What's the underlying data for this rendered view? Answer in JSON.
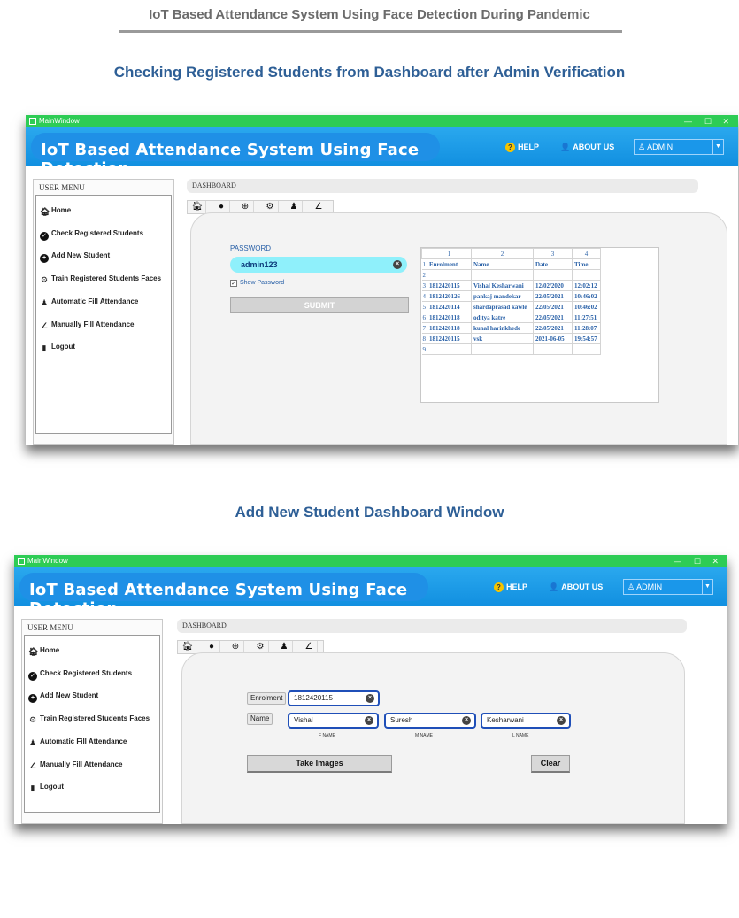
{
  "document": {
    "header": "IoT Based Attendance System Using Face Detection During Pandemic",
    "section1_title": "Checking Registered Students from Dashboard after Admin Verification",
    "section2_title": "Add New Student Dashboard Window"
  },
  "window": {
    "title": "MainWindow",
    "controls": {
      "minimize": "—",
      "maximize": "☐",
      "close": "✕"
    },
    "app_title": "IoT Based Attendance System Using Face Detection",
    "help": "HELP",
    "about": "ABOUT US",
    "user_select": "ADMIN"
  },
  "sidebar": {
    "title": "USER MENU",
    "items": [
      {
        "label": "Home",
        "icon": "home-icon"
      },
      {
        "label": "Check Registered Students",
        "icon": "check-circle-icon"
      },
      {
        "label": "Add New Student",
        "icon": "plus-circle-icon"
      },
      {
        "label": "Train Registered Students Faces",
        "icon": "gear-icon"
      },
      {
        "label": "Automatic Fill Attendance",
        "icon": "user-badge-icon"
      },
      {
        "label": "Manually Fill Attendance",
        "icon": "pencil-icon"
      },
      {
        "label": "Logout",
        "icon": "logout-icon"
      }
    ]
  },
  "breadcrumb": "DASHBOARD",
  "tabs": [
    "home-icon",
    "check-circle-icon",
    "plus-circle-icon",
    "gear-icon",
    "user-badge-icon",
    "pencil-icon"
  ],
  "check_students": {
    "password_label": "PASSWORD",
    "password_value": "admin123",
    "show_password_label": "Show Password",
    "show_password_checked": true,
    "submit_label": "SUBMIT",
    "table": {
      "column_numbers": [
        "1",
        "2",
        "3",
        "4"
      ],
      "rows": [
        {
          "n": "1",
          "cells": [
            "Enrolment",
            "Name",
            "Date",
            "Time"
          ]
        },
        {
          "n": "2",
          "cells": [
            "",
            "",
            "",
            ""
          ]
        },
        {
          "n": "3",
          "cells": [
            "1812420115",
            "Vishal Kesharwani",
            "12/02/2020",
            "12:02:12"
          ]
        },
        {
          "n": "4",
          "cells": [
            "1812420126",
            "pankaj mandekar",
            "22/05/2021",
            "10:46:02"
          ]
        },
        {
          "n": "5",
          "cells": [
            "1812420114",
            "shardaprasad kawle",
            "22/05/2021",
            "10:46:02"
          ]
        },
        {
          "n": "6",
          "cells": [
            "1812420118",
            "oditya katre",
            "22/05/2021",
            "11:27:51"
          ]
        },
        {
          "n": "7",
          "cells": [
            "1812420118",
            "kunal harinkhede",
            "22/05/2021",
            "11:28:07"
          ]
        },
        {
          "n": "8",
          "cells": [
            "1812420115",
            "vsk",
            "2021-06-05",
            "19:54:57"
          ]
        },
        {
          "n": "9",
          "cells": [
            "",
            "",
            "",
            ""
          ]
        }
      ]
    }
  },
  "add_student": {
    "enrolment_label": "Enrolment",
    "enrolment_value": "1812420115",
    "name_label": "Name",
    "first_name": "Vishal",
    "middle_name": "Suresh",
    "last_name": "Kesharwani",
    "fname_caption": "F NAME",
    "mname_caption": "M NAME",
    "lname_caption": "L NAME",
    "take_images_label": "Take Images",
    "clear_label": "Clear"
  },
  "colors": {
    "titlebar": "#2ecc55",
    "banner": "#1a9be8",
    "accent_text": "#2b62a8",
    "password_field": "#8ff0fb",
    "input_border": "#1f4fb8"
  }
}
